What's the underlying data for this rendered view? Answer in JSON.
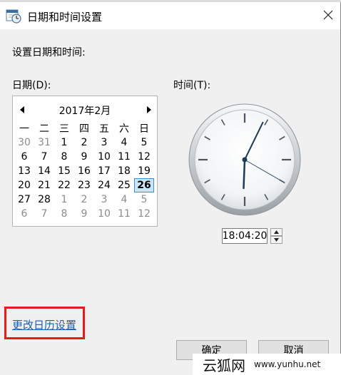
{
  "window": {
    "title": "日期和时间设置"
  },
  "heading": "设置日期和时间:",
  "date_label": "日期(D):",
  "time_label": "时间(T):",
  "calendar": {
    "month_label": "2017年2月",
    "weekdays": [
      "一",
      "二",
      "三",
      "四",
      "五",
      "六",
      "日"
    ],
    "weeks": [
      [
        {
          "d": "30",
          "dim": true
        },
        {
          "d": "31",
          "dim": true
        },
        {
          "d": "1"
        },
        {
          "d": "2"
        },
        {
          "d": "3"
        },
        {
          "d": "4"
        },
        {
          "d": "5"
        }
      ],
      [
        {
          "d": "6"
        },
        {
          "d": "7"
        },
        {
          "d": "8"
        },
        {
          "d": "9"
        },
        {
          "d": "10"
        },
        {
          "d": "11"
        },
        {
          "d": "12"
        }
      ],
      [
        {
          "d": "13"
        },
        {
          "d": "14"
        },
        {
          "d": "15"
        },
        {
          "d": "16"
        },
        {
          "d": "17"
        },
        {
          "d": "18"
        },
        {
          "d": "19"
        }
      ],
      [
        {
          "d": "20"
        },
        {
          "d": "21"
        },
        {
          "d": "22"
        },
        {
          "d": "23"
        },
        {
          "d": "24"
        },
        {
          "d": "25"
        },
        {
          "d": "26",
          "selected": true
        }
      ],
      [
        {
          "d": "27"
        },
        {
          "d": "28"
        },
        {
          "d": "1",
          "dim": true
        },
        {
          "d": "2",
          "dim": true
        },
        {
          "d": "3",
          "dim": true
        },
        {
          "d": "4",
          "dim": true
        },
        {
          "d": "5",
          "dim": true
        }
      ],
      [
        {
          "d": "6",
          "dim": true
        },
        {
          "d": "7",
          "dim": true
        },
        {
          "d": "8",
          "dim": true
        },
        {
          "d": "9",
          "dim": true
        },
        {
          "d": "10",
          "dim": true
        },
        {
          "d": "11",
          "dim": true
        },
        {
          "d": "12",
          "dim": true
        }
      ]
    ]
  },
  "clock": {
    "hours": 18,
    "minutes": 4,
    "seconds": 20
  },
  "time_value": "18:04:20",
  "change_calendar_link": "更改日历设置",
  "buttons": {
    "ok": "确定",
    "cancel": "取消"
  },
  "watermark": {
    "cn": "云狐网",
    "url": "www.yunhu.net"
  },
  "colors": {
    "highlight": "#e21b1b",
    "link": "#1a5fb4",
    "selected_bg": "#cce4f7",
    "selected_border": "#3b8fd9"
  }
}
